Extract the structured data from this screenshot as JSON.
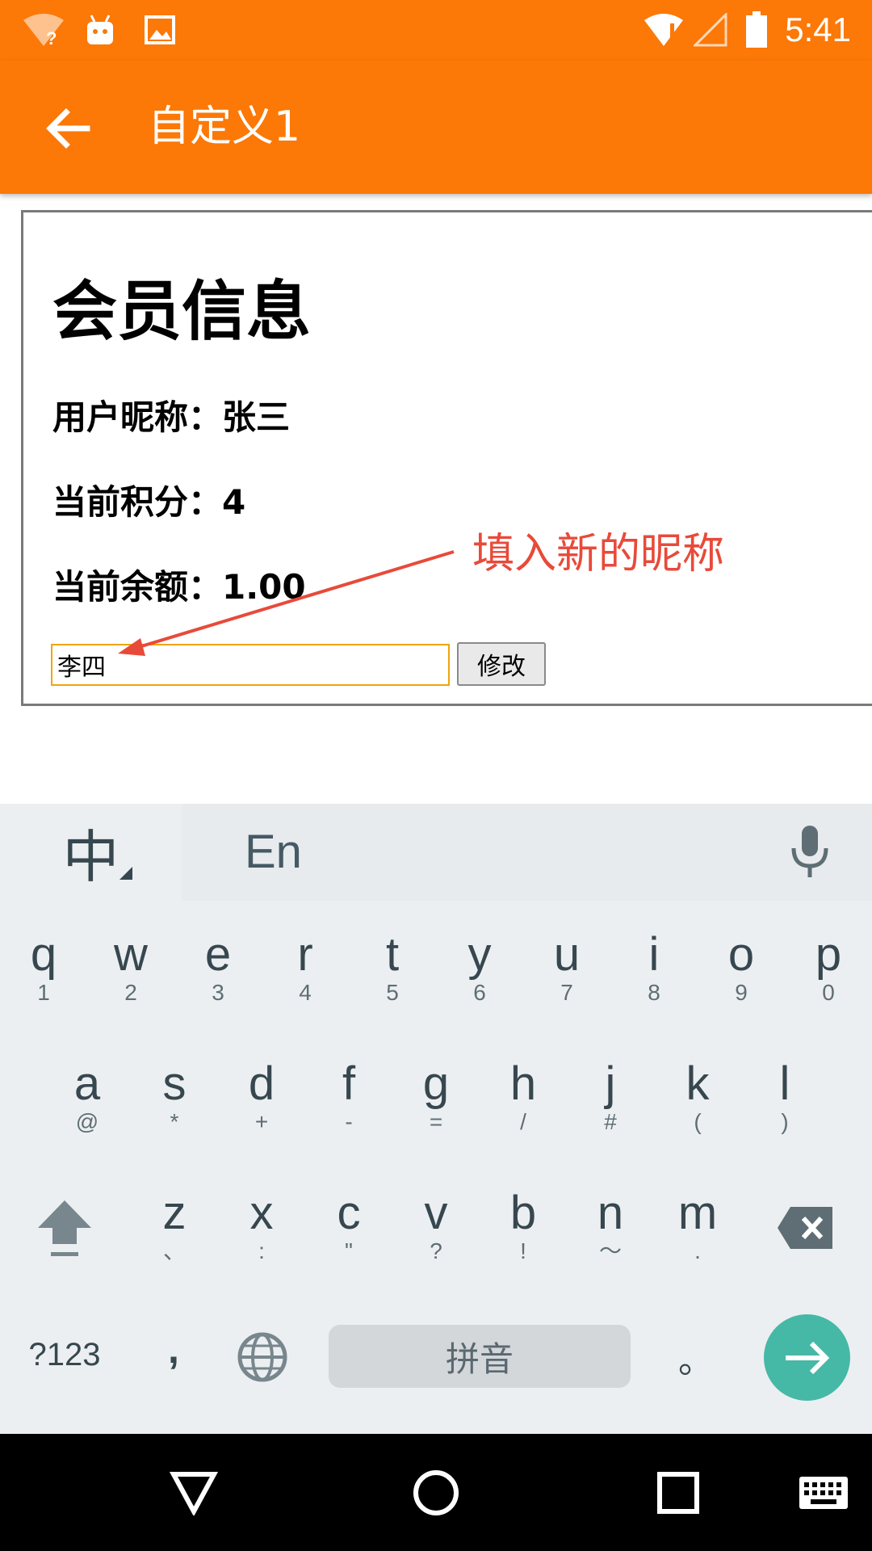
{
  "status_bar": {
    "time": "5:41",
    "icons": [
      "wifi-unknown-icon",
      "android-icon",
      "image-icon",
      "wifi-alert-icon",
      "signal-icon",
      "battery-icon"
    ]
  },
  "app_bar": {
    "title": "自定义1",
    "back_icon": "arrow-left-icon"
  },
  "page": {
    "heading": "会员信息",
    "nickname_row": "用户昵称：张三",
    "points_row": "当前积分：4",
    "balance_row": "当前余额：1.00",
    "nickname_input_value": "李四",
    "modify_button": "修改"
  },
  "annotation": {
    "text": "填入新的昵称",
    "color": "#e84a3a"
  },
  "keyboard": {
    "lang_toggle": "中",
    "candidate": "En",
    "row1": [
      {
        "k": "q",
        "s": "1"
      },
      {
        "k": "w",
        "s": "2"
      },
      {
        "k": "e",
        "s": "3"
      },
      {
        "k": "r",
        "s": "4"
      },
      {
        "k": "t",
        "s": "5"
      },
      {
        "k": "y",
        "s": "6"
      },
      {
        "k": "u",
        "s": "7"
      },
      {
        "k": "i",
        "s": "8"
      },
      {
        "k": "o",
        "s": "9"
      },
      {
        "k": "p",
        "s": "0"
      }
    ],
    "row2": [
      {
        "k": "a",
        "s": "@"
      },
      {
        "k": "s",
        "s": "*"
      },
      {
        "k": "d",
        "s": "+"
      },
      {
        "k": "f",
        "s": "-"
      },
      {
        "k": "g",
        "s": "="
      },
      {
        "k": "h",
        "s": "/"
      },
      {
        "k": "j",
        "s": "#"
      },
      {
        "k": "k",
        "s": "("
      },
      {
        "k": "l",
        "s": ")"
      }
    ],
    "row3": [
      {
        "k": "z",
        "s": "、"
      },
      {
        "k": "x",
        "s": ":"
      },
      {
        "k": "c",
        "s": "\""
      },
      {
        "k": "v",
        "s": "?"
      },
      {
        "k": "b",
        "s": "!"
      },
      {
        "k": "n",
        "s": "～"
      },
      {
        "k": "m",
        "s": "."
      }
    ],
    "symbols_key": "?123",
    "comma_key": ",",
    "space_key": "拼音",
    "period_key": "。"
  },
  "colors": {
    "accent": "#fc7807",
    "enter": "#46b8a6",
    "keyboard_bg": "#eceff1"
  }
}
